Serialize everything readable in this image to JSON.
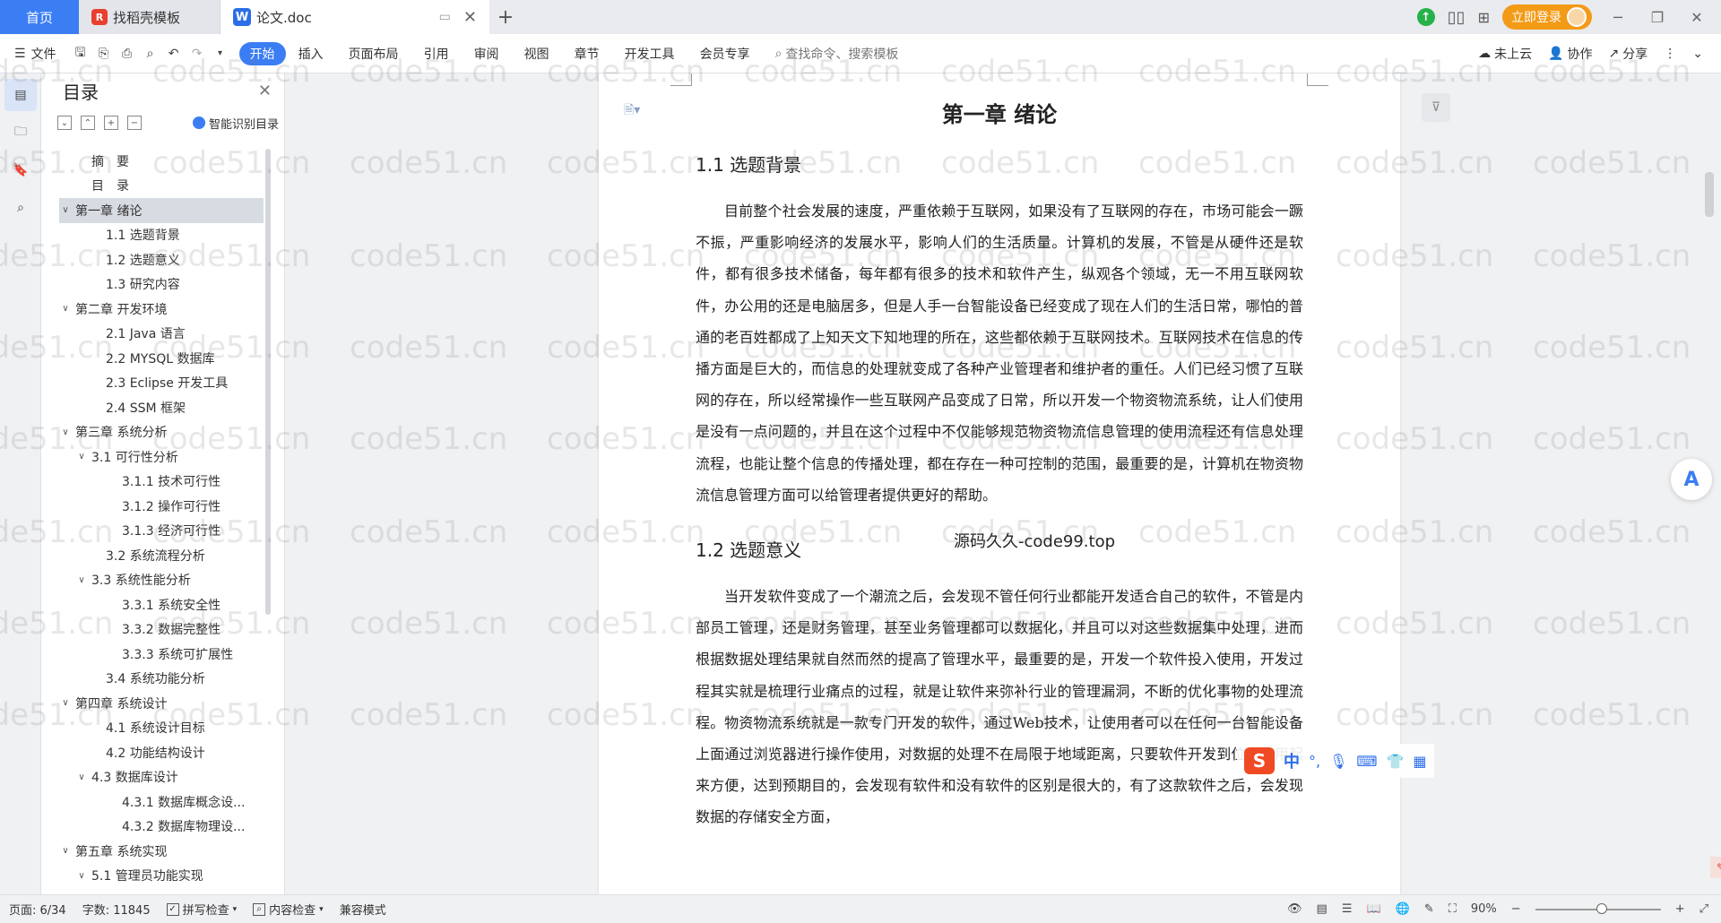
{
  "tabs": {
    "home": "首页",
    "template": "找稻壳模板",
    "doc": "论文.doc",
    "template_logo": "R",
    "doc_logo": "W",
    "login": "立即登录"
  },
  "menu": {
    "file": "文件",
    "items": [
      "开始",
      "插入",
      "页面布局",
      "引用",
      "审阅",
      "视图",
      "章节",
      "开发工具",
      "会员专享"
    ],
    "search": "查找命令、搜索模板",
    "cloud": "未上云",
    "collab": "协作",
    "share": "分享"
  },
  "toc": {
    "title": "目录",
    "smart": "智能识别目录",
    "items": [
      {
        "text": "摘　要",
        "level": 1,
        "caret": ""
      },
      {
        "text": "目　录",
        "level": 1,
        "caret": ""
      },
      {
        "text": "第一章  绪论",
        "level": 0,
        "caret": "∨",
        "selected": true
      },
      {
        "text": "1.1  选题背景",
        "level": 2,
        "caret": ""
      },
      {
        "text": "1.2  选题意义",
        "level": 2,
        "caret": ""
      },
      {
        "text": "1.3  研究内容",
        "level": 2,
        "caret": ""
      },
      {
        "text": "第二章  开发环境",
        "level": 0,
        "caret": "∨"
      },
      {
        "text": "2.1 Java 语言",
        "level": 2,
        "caret": ""
      },
      {
        "text": "2.2 MYSQL 数据库",
        "level": 2,
        "caret": ""
      },
      {
        "text": "2.3 Eclipse 开发工具",
        "level": 2,
        "caret": ""
      },
      {
        "text": "2.4 SSM 框架",
        "level": 2,
        "caret": ""
      },
      {
        "text": "第三章  系统分析",
        "level": 0,
        "caret": "∨"
      },
      {
        "text": "3.1 可行性分析",
        "level": 1,
        "caret": "∨"
      },
      {
        "text": "3.1.1 技术可行性",
        "level": 3,
        "caret": ""
      },
      {
        "text": "3.1.2 操作可行性",
        "level": 3,
        "caret": ""
      },
      {
        "text": "3.1.3 经济可行性",
        "level": 3,
        "caret": ""
      },
      {
        "text": "3.2 系统流程分析",
        "level": 2,
        "caret": ""
      },
      {
        "text": "3.3 系统性能分析",
        "level": 1,
        "caret": "∨"
      },
      {
        "text": "3.3.1 系统安全性",
        "level": 3,
        "caret": ""
      },
      {
        "text": "3.3.2 数据完整性",
        "level": 3,
        "caret": ""
      },
      {
        "text": "3.3.3 系统可扩展性",
        "level": 3,
        "caret": ""
      },
      {
        "text": "3.4 系统功能分析",
        "level": 2,
        "caret": ""
      },
      {
        "text": "第四章  系统设计",
        "level": 0,
        "caret": "∨"
      },
      {
        "text": "4.1  系统设计目标",
        "level": 2,
        "caret": ""
      },
      {
        "text": "4.2 功能结构设计",
        "level": 2,
        "caret": ""
      },
      {
        "text": "4.3 数据库设计",
        "level": 1,
        "caret": "∨"
      },
      {
        "text": "4.3.1  数据库概念设...",
        "level": 3,
        "caret": ""
      },
      {
        "text": "4.3.2  数据库物理设...",
        "level": 3,
        "caret": ""
      },
      {
        "text": "第五章  系统实现",
        "level": 0,
        "caret": "∨"
      },
      {
        "text": "5.1 管理员功能实现",
        "level": 1,
        "caret": "∨"
      }
    ]
  },
  "document": {
    "chapter_title": "第一章  绪论",
    "sections": [
      {
        "title": "1.1  选题背景",
        "paragraph": "目前整个社会发展的速度，严重依赖于互联网，如果没有了互联网的存在，市场可能会一蹶不振，严重影响经济的发展水平，影响人们的生活质量。计算机的发展，不管是从硬件还是软件，都有很多技术储备，每年都有很多的技术和软件产生，纵观各个领域，无一不用互联网软件，办公用的还是电脑居多，但是人手一台智能设备已经变成了现在人们的生活日常，哪怕的普通的老百姓都成了上知天文下知地理的所在，这些都依赖于互联网技术。互联网技术在信息的传播方面是巨大的，而信息的处理就变成了各种产业管理者和维护者的重任。人们已经习惯了互联网的存在，所以经常操作一些互联网产品变成了日常，所以开发一个物资物流系统，让人们使用是没有一点问题的，并且在这个过程中不仅能够规范物资物流信息管理的使用流程还有信息处理流程，也能让整个信息的传播处理，都在存在一种可控制的范围，最重要的是，计算机在物资物流信息管理方面可以给管理者提供更好的帮助。"
      },
      {
        "title": "1.2  选题意义",
        "paragraph": "当开发软件变成了一个潮流之后，会发现不管任何行业都能开发适合自己的软件，不管是内部员工管理，还是财务管理，甚至业务管理都可以数据化，并且可以对这些数据集中处理，进而根据数据处理结果就自然而然的提高了管理水平，最重要的是，开发一个软件投入使用，开发过程其实就是梳理行业痛点的过程，就是让软件来弥补行业的管理漏洞，不断的优化事物的处理流程。物资物流系统就是一款专门开发的软件，通过Web技术，让使用者可以在任何一台智能设备上面通过浏览器进行操作使用，对数据的处理不在局限于地域距离，只要软件开发到位，使用起来方便，达到预期目的，会发现有软件和没有软件的区别是很大的，有了这款软件之后，会发现数据的存储安全方面，"
      }
    ],
    "overlay": "源码久久-code99.top",
    "watermark": "code51.cn"
  },
  "ime": {
    "mode": "中",
    "punct": "°,"
  },
  "status": {
    "page": "页面: 6/34",
    "words": "字数: 11845",
    "spell": "拼写检查",
    "content_check": "内容检查",
    "compat": "兼容模式",
    "zoom": "90%"
  }
}
